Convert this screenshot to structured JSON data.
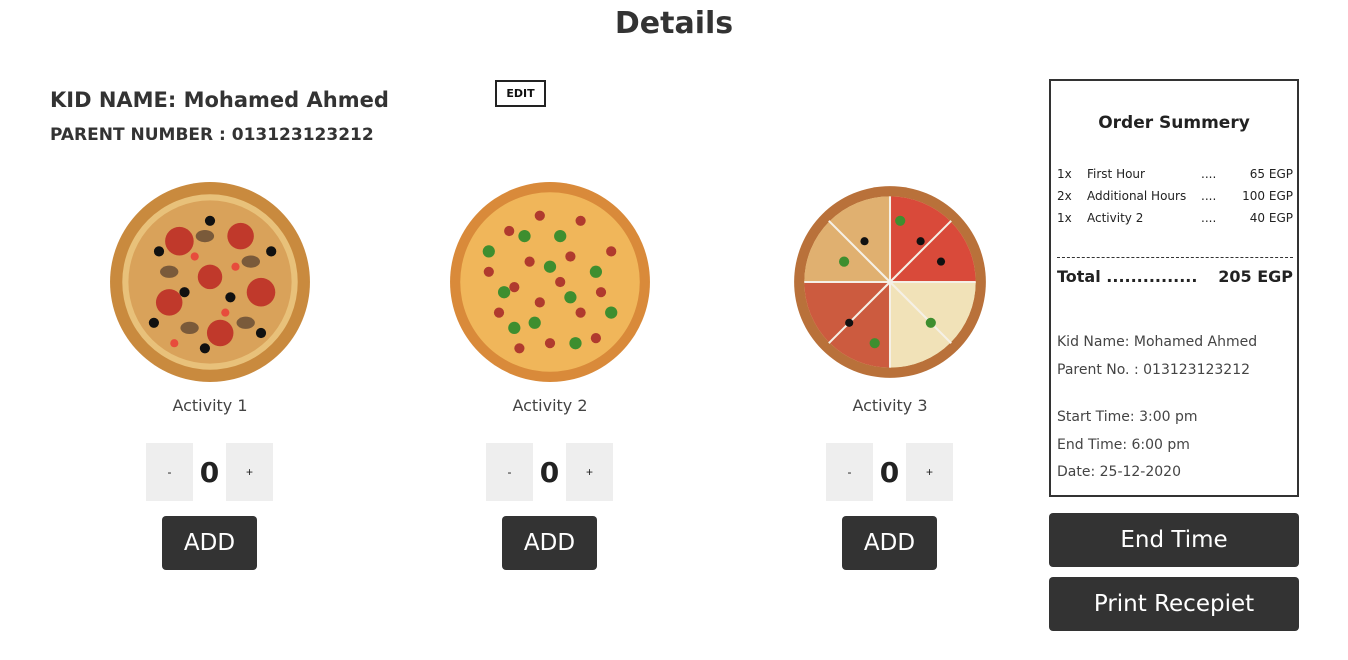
{
  "page": {
    "title": "Details"
  },
  "kid": {
    "name_line": "KID NAME: Mohamed Ahmed",
    "parent_line": "PARENT NUMBER : 013123123212",
    "edit_label": "EDIT"
  },
  "activities": [
    {
      "label": "Activity 1",
      "quantity": "0",
      "minus": "-",
      "plus": "+",
      "add_label": "ADD",
      "image": "pizza-image"
    },
    {
      "label": "Activity 2",
      "quantity": "0",
      "minus": "-",
      "plus": "+",
      "add_label": "ADD",
      "image": "pizza-image"
    },
    {
      "label": "Activity 3",
      "quantity": "0",
      "minus": "-",
      "plus": "+",
      "add_label": "ADD",
      "image": "pizza-image"
    }
  ],
  "summary": {
    "title": "Order Summery",
    "items": [
      {
        "qty": "1x",
        "name": "First Hour",
        "dots": "....",
        "price": "65 EGP"
      },
      {
        "qty": "2x",
        "name": "Additional Hours",
        "dots": "....",
        "price": "100 EGP"
      },
      {
        "qty": "1x",
        "name": "Activity 2",
        "dots": "....",
        "price": "40 EGP"
      }
    ],
    "total_label": "Total ...............",
    "total_value": "205 EGP",
    "kid_name": "Kid Name: Mohamed Ahmed",
    "parent_no": "Parent No. : 013123123212",
    "start_time": "Start Time: 3:00 pm",
    "end_time": "End Time: 6:00 pm",
    "date": "Date: 25-12-2020"
  },
  "actions": {
    "end_time_label": "End Time",
    "print_label": "Print Recepiet"
  },
  "colors": {
    "dark_button": "#333333",
    "stepper_bg": "#eeeeee",
    "text": "#333333"
  }
}
